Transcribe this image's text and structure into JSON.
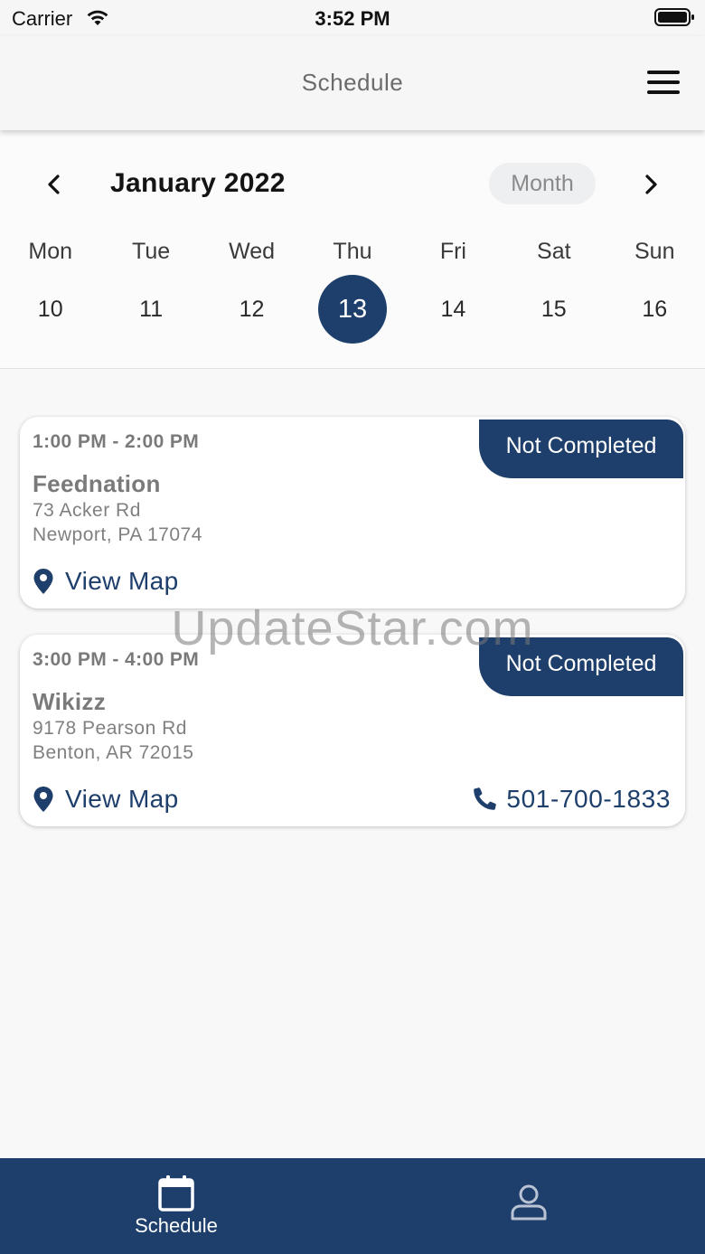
{
  "status_bar": {
    "carrier": "Carrier",
    "time": "3:52 PM"
  },
  "header": {
    "title": "Schedule",
    "menu_icon": "hamburger-menu-icon"
  },
  "calendar": {
    "month_label": "January 2022",
    "view_toggle": "Month",
    "weekdays": [
      "Mon",
      "Tue",
      "Wed",
      "Thu",
      "Fri",
      "Sat",
      "Sun"
    ],
    "dates": [
      "10",
      "11",
      "12",
      "13",
      "14",
      "15",
      "16"
    ],
    "selected_date": "13"
  },
  "appointments": [
    {
      "time": "1:00 PM - 2:00 PM",
      "status": "Not Completed",
      "name": "Feednation",
      "address_line1": "73 Acker Rd",
      "address_line2": "Newport, PA  17074",
      "map_label": "View Map"
    },
    {
      "time": "3:00 PM - 4:00 PM",
      "status": "Not Completed",
      "name": "Wikizz",
      "address_line1": "9178 Pearson Rd",
      "address_line2": "Benton, AR  72015",
      "map_label": "View Map",
      "phone": "501-700-1833"
    }
  ],
  "watermark": "UpdateStar.com",
  "tab_bar": {
    "schedule_label": "Schedule"
  },
  "colors": {
    "accent": "#1e3f6b",
    "background": "#f8f8f9",
    "muted_text": "#7a7a7a"
  }
}
